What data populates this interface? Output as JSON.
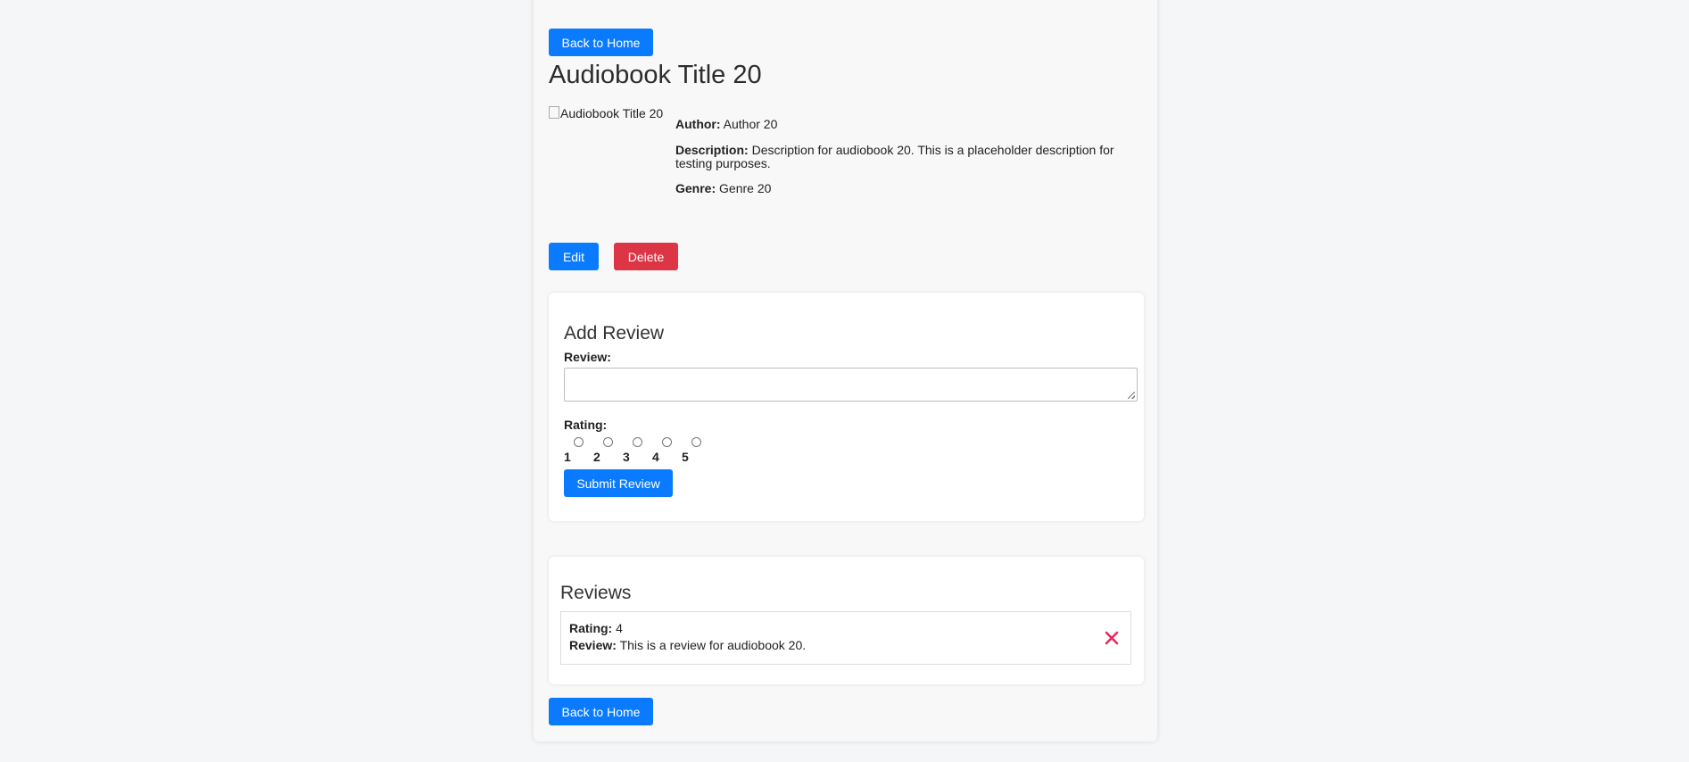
{
  "nav": {
    "back_label": "Back to Home"
  },
  "audiobook": {
    "title": "Audiobook Title 20",
    "cover_alt": "Audiobook Title 20",
    "author_label": "Author:",
    "author": "Author 20",
    "description_label": "Description:",
    "description": "Description for audiobook 20. This is a placeholder description for testing purposes.",
    "genre_label": "Genre:",
    "genre": "Genre 20"
  },
  "actions": {
    "edit_label": "Edit",
    "delete_label": "Delete"
  },
  "add_review": {
    "heading": "Add Review",
    "review_label": "Review:",
    "review_value": "",
    "rating_label": "Rating:",
    "rating_options": [
      "1",
      "2",
      "3",
      "4",
      "5"
    ],
    "submit_label": "Submit Review"
  },
  "reviews": {
    "heading": "Reviews",
    "items": [
      {
        "rating_label": "Rating:",
        "rating": "4",
        "review_label": "Review:",
        "text": "This is a review for audiobook 20."
      }
    ]
  },
  "colors": {
    "primary": "#0a7bff",
    "danger": "#dc3545",
    "close_icon": "#e8265e"
  },
  "icons": {
    "review_delete": "close-icon"
  }
}
